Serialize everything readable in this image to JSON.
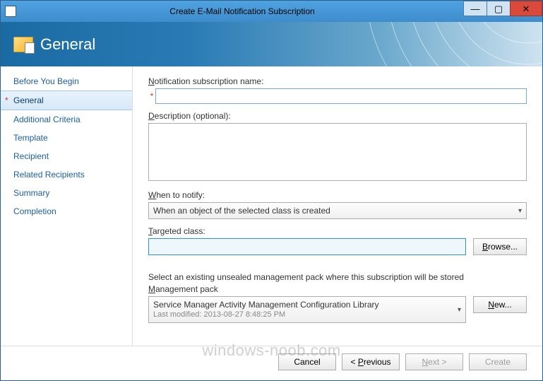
{
  "window": {
    "title": "Create E-Mail Notification Subscription"
  },
  "header": {
    "title": "General"
  },
  "sidebar": {
    "steps": [
      {
        "label": "Before You Begin",
        "active": false,
        "required": false
      },
      {
        "label": "General",
        "active": true,
        "required": true
      },
      {
        "label": "Additional Criteria",
        "active": false,
        "required": false
      },
      {
        "label": "Template",
        "active": false,
        "required": false
      },
      {
        "label": "Recipient",
        "active": false,
        "required": false
      },
      {
        "label": "Related Recipients",
        "active": false,
        "required": false
      },
      {
        "label": "Summary",
        "active": false,
        "required": false
      },
      {
        "label": "Completion",
        "active": false,
        "required": false
      }
    ]
  },
  "form": {
    "name_label_pre": "N",
    "name_label_post": "otification subscription name:",
    "name_value": "",
    "desc_label_pre": "D",
    "desc_label_post": "escription (optional):",
    "desc_value": "",
    "when_label_pre": "W",
    "when_label_post": "hen to notify:",
    "when_value": "When an object of the selected class is created",
    "target_label_pre": "T",
    "target_label_post": "argeted class:",
    "target_value": "",
    "browse_label": "Browse...",
    "mp_intro": "Select an existing unsealed management pack where this subscription will be stored",
    "mp_label_pre": "M",
    "mp_label_post": "anagement pack",
    "mp_value": "Service Manager Activity Management Configuration Library",
    "mp_sub_prefix": "Last modified:",
    "mp_sub_value": "2013-08-27 8:48:25 PM",
    "new_label": "New..."
  },
  "footer": {
    "cancel": "Cancel",
    "previous": "< Previous",
    "next": "Next >",
    "create": "Create"
  },
  "watermark": "windows-noob.com"
}
